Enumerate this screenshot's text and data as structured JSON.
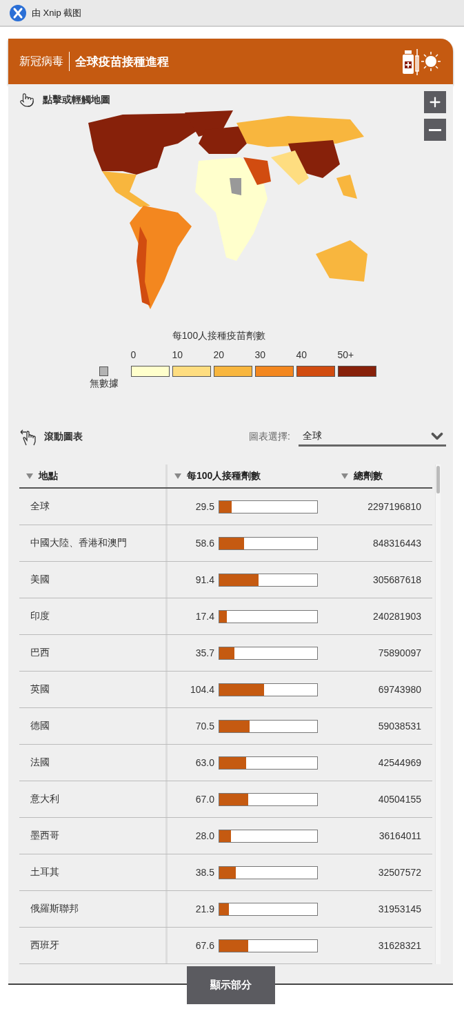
{
  "app_bar": {
    "title": "由 Xnip 截图"
  },
  "header": {
    "section": "新冠病毒",
    "title": "全球疫苗接種進程"
  },
  "map": {
    "hint": "點擊或輕觸地圖"
  },
  "legend": {
    "title": "每100人接種疫苗劑數",
    "no_data": {
      "label": "無數據",
      "color": "#b3b3b3"
    },
    "bins": [
      {
        "label": "0",
        "color": "#ffffcc"
      },
      {
        "label": "10",
        "color": "#fedd80"
      },
      {
        "label": "20",
        "color": "#f8b63e"
      },
      {
        "label": "30",
        "color": "#f3871f"
      },
      {
        "label": "40",
        "color": "#d14c10"
      },
      {
        "label": "50+",
        "color": "#87210a"
      }
    ]
  },
  "table_controls": {
    "scroll_hint": "滾動圖表",
    "select_label": "圖表選擇:",
    "select_value": "全球"
  },
  "table": {
    "columns": [
      "地點",
      "每100人接種劑數",
      "總劑數"
    ],
    "rows": [
      {
        "place": "全球",
        "per_100": "29.5",
        "level": 0.129,
        "total": "2297196810"
      },
      {
        "place": "中國大陸、香港和澳門",
        "per_100": "58.6",
        "level": 0.257,
        "total": "848316443"
      },
      {
        "place": "美國",
        "per_100": "91.4",
        "level": 0.401,
        "total": "305687618"
      },
      {
        "place": "印度",
        "per_100": "17.4",
        "level": 0.076,
        "total": "240281903"
      },
      {
        "place": "巴西",
        "per_100": "35.7",
        "level": 0.157,
        "total": "75890097"
      },
      {
        "place": "英國",
        "per_100": "104.4",
        "level": 0.458,
        "total": "69743980"
      },
      {
        "place": "德國",
        "per_100": "70.5",
        "level": 0.309,
        "total": "59038531"
      },
      {
        "place": "法國",
        "per_100": "63.0",
        "level": 0.276,
        "total": "42544969"
      },
      {
        "place": "意大利",
        "per_100": "67.0",
        "level": 0.294,
        "total": "40504155"
      },
      {
        "place": "墨西哥",
        "per_100": "28.0",
        "level": 0.123,
        "total": "36164011"
      },
      {
        "place": "土耳其",
        "per_100": "38.5",
        "level": 0.169,
        "total": "32507572"
      },
      {
        "place": "俄羅斯聯邦",
        "per_100": "21.9",
        "level": 0.096,
        "total": "31953145"
      },
      {
        "place": "西班牙",
        "per_100": "67.6",
        "level": 0.296,
        "total": "31628321"
      }
    ]
  },
  "show_button": "顯示部分"
}
